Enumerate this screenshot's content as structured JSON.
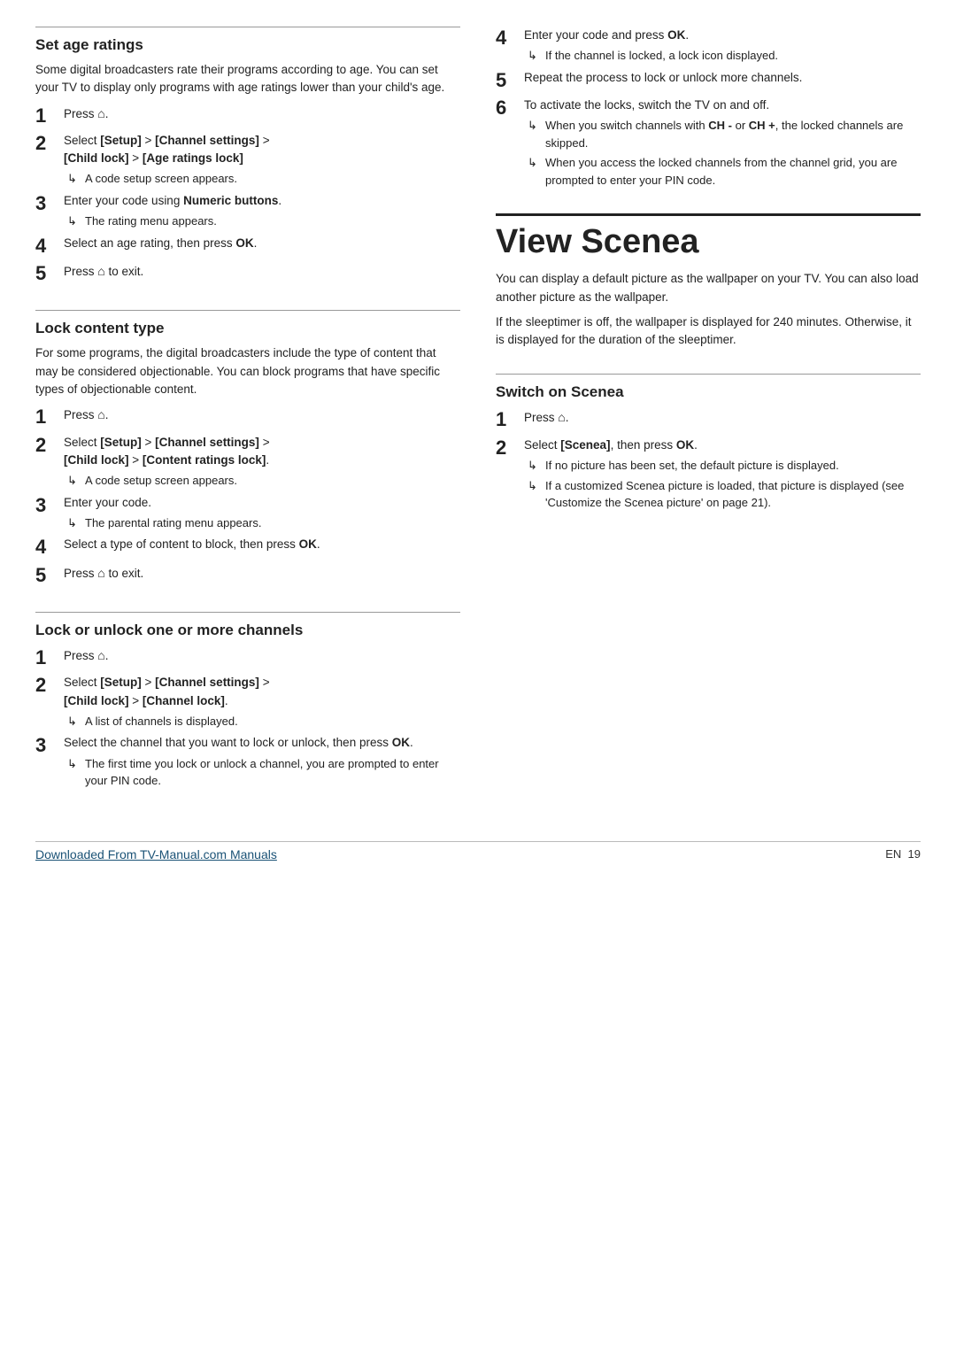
{
  "left": {
    "set_age_ratings": {
      "title": "Set age ratings",
      "body": "Some digital broadcasters rate their programs according to age. You can set your TV to display only programs with age ratings lower than your child's age.",
      "steps": [
        {
          "num": "1",
          "text": "Press ",
          "icon": "home",
          "rest": "."
        },
        {
          "num": "2",
          "text": "Select [Setup] > [Channel settings] > [Child lock] > [Age ratings lock]",
          "sub": [
            "A code setup screen appears."
          ]
        },
        {
          "num": "3",
          "text": "Enter your code using Numeric buttons.",
          "bold_phrase": "Numeric buttons",
          "sub": [
            "The rating menu appears."
          ]
        },
        {
          "num": "4",
          "text": "Select an age rating, then press OK."
        },
        {
          "num": "5",
          "text": "Press ",
          "icon": "home",
          "rest": " to exit."
        }
      ]
    },
    "lock_content_type": {
      "title": "Lock content type",
      "body": "For some programs, the digital broadcasters include the type of content that may be considered objectionable. You can block programs that have specific types of objectionable content.",
      "steps": [
        {
          "num": "1",
          "text": "Press ",
          "icon": "home",
          "rest": "."
        },
        {
          "num": "2",
          "text": "Select [Setup] > [Channel settings] > [Child lock] > [Content ratings lock].",
          "sub": [
            "A code setup screen appears."
          ]
        },
        {
          "num": "3",
          "text": "Enter your code.",
          "sub": [
            "The parental rating menu appears."
          ]
        },
        {
          "num": "4",
          "text": "Select a type of content to block, then press OK."
        },
        {
          "num": "5",
          "text": "Press ",
          "icon": "home",
          "rest": " to exit."
        }
      ]
    },
    "lock_unlock_channels": {
      "title": "Lock or unlock one or more channels",
      "steps": [
        {
          "num": "1",
          "text": "Press ",
          "icon": "home",
          "rest": "."
        },
        {
          "num": "2",
          "text": "Select [Setup] > [Channel settings] > [Child lock] > [Channel lock].",
          "sub": [
            "A list of channels is displayed."
          ]
        },
        {
          "num": "3",
          "text": "Select the channel that you want to lock or unlock, then press OK.",
          "sub": [
            "The first time you lock or unlock a channel, you are prompted to enter your PIN code."
          ]
        }
      ]
    }
  },
  "right": {
    "lock_unlock_continued": {
      "steps": [
        {
          "num": "4",
          "text": "Enter your code and press OK.",
          "sub": [
            "If the channel is locked, a lock icon displayed."
          ]
        },
        {
          "num": "5",
          "text": "Repeat the process to lock or unlock more channels."
        },
        {
          "num": "6",
          "text": "To activate the locks, switch the TV on and off.",
          "sub": [
            "When you switch channels with CH - or CH +, the locked channels are skipped.",
            "When you access the locked channels from the channel grid, you are prompted to enter your PIN code."
          ]
        }
      ]
    },
    "view_scenea": {
      "title": "View Scenea",
      "body1": "You can display a default picture as the wallpaper on your TV. You can also load another picture as the wallpaper.",
      "body2": "If the sleeptimer is off, the wallpaper is displayed for 240 minutes. Otherwise, it is displayed for the duration of the sleeptimer."
    },
    "switch_on_scenea": {
      "title": "Switch on Scenea",
      "steps": [
        {
          "num": "1",
          "text": "Press ",
          "icon": "home",
          "rest": "."
        },
        {
          "num": "2",
          "text": "Select [Scenea], then press OK.",
          "sub": [
            "If no picture has been set, the default picture is displayed.",
            "If a customized Scenea picture is loaded, that picture is displayed (see 'Customize the Scenea picture' on page 21)."
          ]
        }
      ]
    }
  },
  "footer": {
    "link_text": "Downloaded From TV-Manual.com Manuals",
    "page_label": "EN",
    "page_num": "19"
  }
}
